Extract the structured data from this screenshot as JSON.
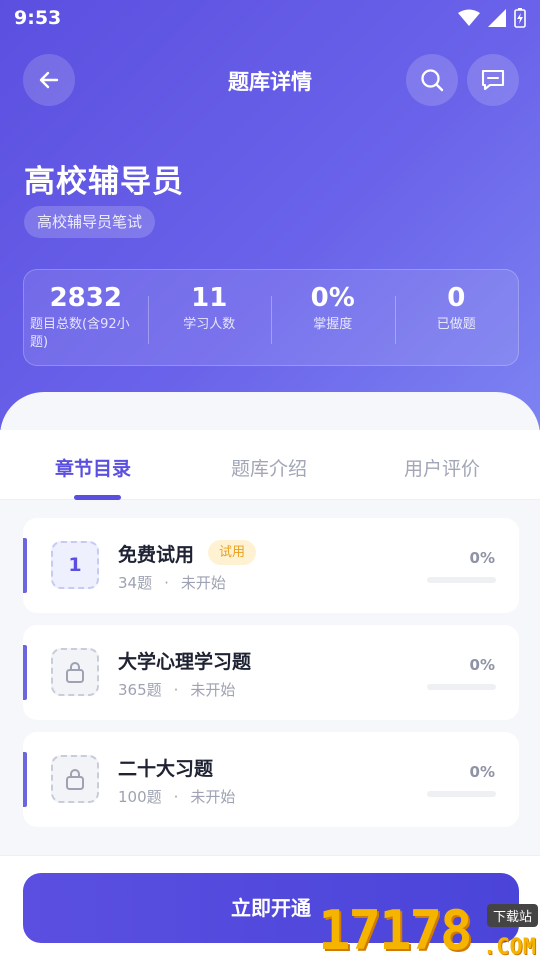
{
  "status_bar": {
    "time": "9:53",
    "icons": [
      "wifi-icon",
      "signal-icon",
      "battery-charging-icon"
    ]
  },
  "header": {
    "title": "题库详情",
    "back_icon": "arrow-left-icon",
    "search_icon": "search-icon",
    "message_icon": "message-icon"
  },
  "bank": {
    "title": "高校辅导员",
    "tag": "高校辅导员笔试",
    "stats": [
      {
        "value": "2832",
        "label": "题目总数(含92小题)"
      },
      {
        "value": "11",
        "label": "学习人数"
      },
      {
        "value": "0%",
        "label": "掌握度"
      },
      {
        "value": "0",
        "label": "已做题"
      }
    ]
  },
  "tabs": [
    {
      "label": "章节目录",
      "active": true
    },
    {
      "label": "题库介绍",
      "active": false
    },
    {
      "label": "用户评价",
      "active": false
    }
  ],
  "chapters": [
    {
      "index": "1",
      "locked": false,
      "name": "免费试用",
      "badge": "试用",
      "count": "34题",
      "status": "未开始",
      "percent": "0%",
      "progress": 0
    },
    {
      "index": "",
      "locked": true,
      "name": "大学心理学习题",
      "badge": "",
      "count": "365题",
      "status": "未开始",
      "percent": "0%",
      "progress": 0
    },
    {
      "index": "",
      "locked": true,
      "name": "二十大习题",
      "badge": "",
      "count": "100题",
      "status": "未开始",
      "percent": "0%",
      "progress": 0
    }
  ],
  "meta_separator": "·",
  "cta": {
    "label": "立即开通"
  },
  "watermark": {
    "text": "17178",
    "suffix": ".COM",
    "tag": "下载站"
  },
  "colors": {
    "primary": "#5b4fe0",
    "trial_bg": "#fff2d3",
    "trial_text": "#e8a020"
  }
}
